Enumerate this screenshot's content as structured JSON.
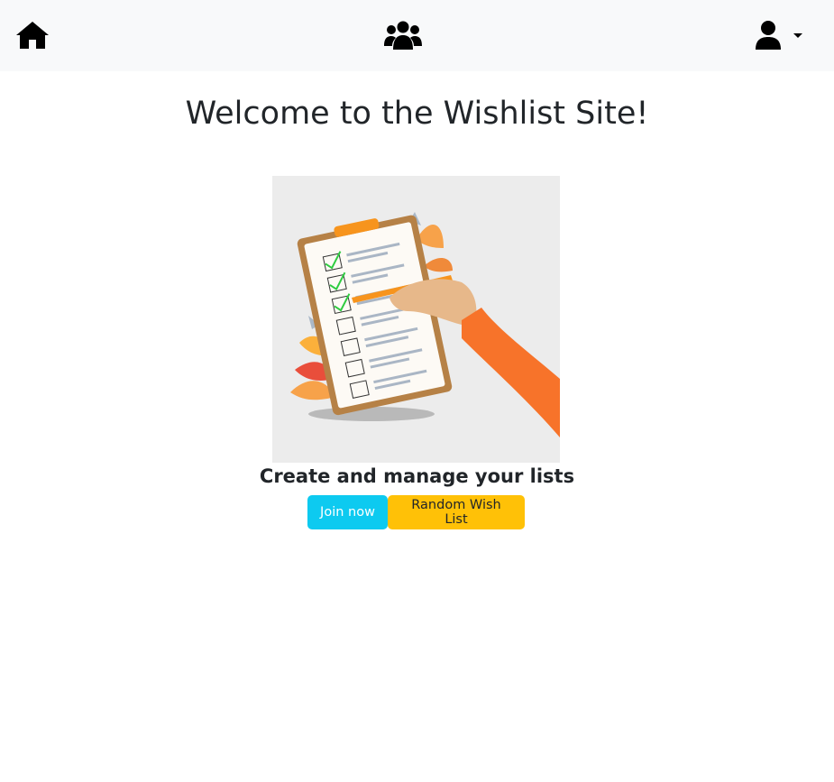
{
  "nav": {
    "home_icon": "home-icon",
    "groups_icon": "users-group-icon",
    "user_icon": "user-icon",
    "dropdown_icon": "caret-down-icon"
  },
  "main": {
    "title": "Welcome to the Wishlist Site!",
    "subtitle": "Create and manage your lists",
    "join_label": "Join now",
    "random_label": "Random Wish List"
  },
  "colors": {
    "navbar_bg": "#f8f9fa",
    "join_button": "#0dcaf0",
    "random_button": "#ffc107",
    "text": "#212529",
    "image_bg": "#ececec"
  }
}
